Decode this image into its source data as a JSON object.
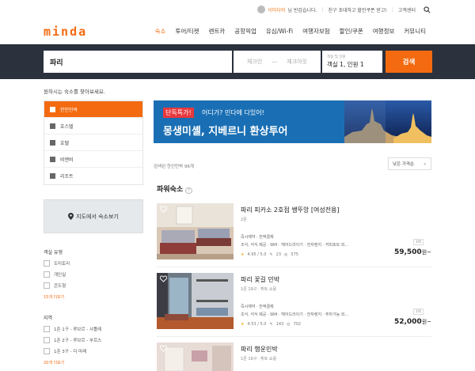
{
  "topbar": {
    "greeting_name": "이미다미",
    "greeting_suffix": "님 반갑습니다.",
    "invite": "친구 초대하고 할인쿠폰 받고!",
    "support": "고객센터"
  },
  "brand": {
    "logo": "minda",
    "accent": "#f46a10"
  },
  "nav": {
    "items": [
      {
        "label": "숙소",
        "active": true
      },
      {
        "label": "투어/티켓"
      },
      {
        "label": "렌트카"
      },
      {
        "label": "공항픽업"
      },
      {
        "label": "유심/Wi-Fi"
      },
      {
        "label": "여행자보험"
      },
      {
        "label": "할인/쿠폰"
      },
      {
        "label": "여행정보"
      },
      {
        "label": "커뮤니티"
      }
    ]
  },
  "search": {
    "destination": "파리",
    "checkin": "체크인",
    "checkout": "체크아웃",
    "dash": "—",
    "guests_label": "객실 및 인원",
    "guests_value": "객실 1, 인원 1",
    "button": "검색"
  },
  "left": {
    "hint": "원하시는 숙소를 찾아보세요.",
    "categories": [
      {
        "label": "한인민박",
        "active": true
      },
      {
        "label": "호스텔"
      },
      {
        "label": "호텔"
      },
      {
        "label": "비앤비"
      },
      {
        "label": "리조트"
      }
    ],
    "map_button": "지도에서 숙소보기",
    "room_type_title": "객실 유형",
    "room_types": [
      "도미토리",
      "개인실",
      "콘도형"
    ],
    "room_types_more": "15개 더보기",
    "region_title": "지역",
    "regions": [
      "1존 1구 - 루브르 - 샤틀레",
      "1존 2구 - 루브르 - 부르스",
      "1존 3구 - 더 마레"
    ],
    "regions_more": "20개 더보기"
  },
  "banner": {
    "tag": "단독특가!",
    "line1": "어디가? 민다에 다있어!",
    "line2": "몽생미셸, 지베르니 환상투어"
  },
  "results": {
    "count_text": "검색된 한인민박 96개",
    "sort": "낮은 가격순",
    "section_title": "파워숙소",
    "section_help": "?",
    "cards": [
      {
        "name": "파리 피카소 2호점 쌩뚜앙 [여성전용]",
        "sub": "2존",
        "amenities1": "즉시예약 · 전액결제",
        "amenities2": "조식, 석식 제공 · Wifi · 헤어드라이기 · 전자렌지 · 커피포트 외...",
        "rating": "4.95 / 5.0",
        "reviews": "23",
        "views": "575",
        "night": "1박",
        "price": "59,500",
        "unit": "원~"
      },
      {
        "name": "파리 꽃길 민박",
        "sub": "1존 19구 · 뷔트 쇼몽",
        "amenities1": "즉시예약 · 전액결제",
        "amenities2": "조식, 석식 제공 · Wifi · 헤어드라이기 · 전자렌지 · 주차가능 외...",
        "rating": "4.53 / 5.0",
        "reviews": "143",
        "views": "702",
        "night": "1박",
        "price": "52,000",
        "unit": "원~"
      },
      {
        "name": "파리 행운민박",
        "sub": "1존 19구 · 뷔트 쇼몽"
      }
    ]
  }
}
